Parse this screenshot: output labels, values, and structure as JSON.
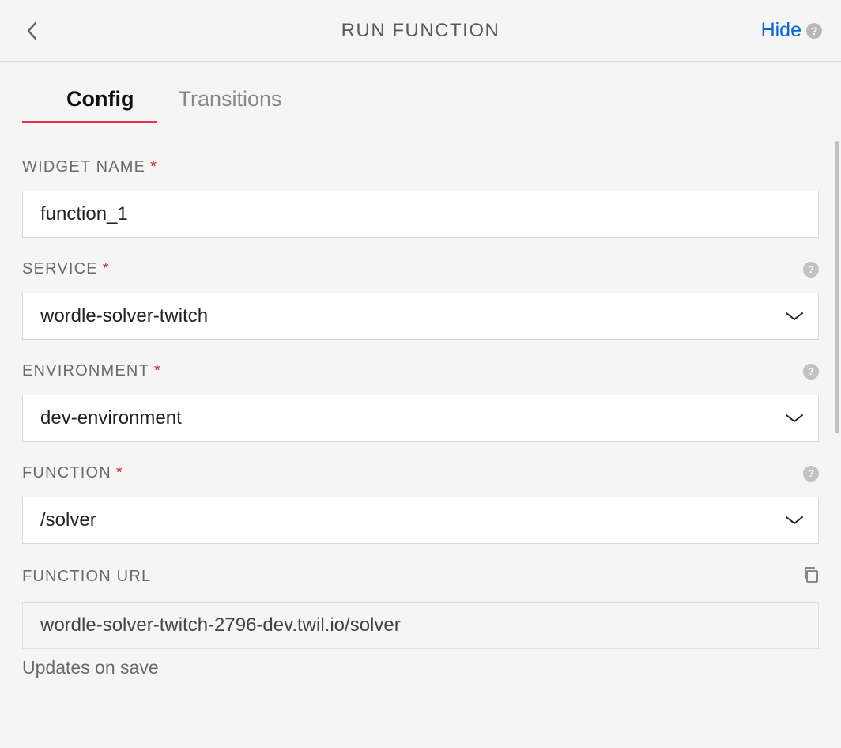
{
  "header": {
    "title": "RUN FUNCTION",
    "hide_label": "Hide"
  },
  "tabs": [
    {
      "label": "Config",
      "active": true
    },
    {
      "label": "Transitions",
      "active": false
    }
  ],
  "fields": {
    "widget_name": {
      "label": "WIDGET NAME",
      "required": true,
      "value": "function_1"
    },
    "service": {
      "label": "SERVICE",
      "required": true,
      "value": "wordle-solver-twitch",
      "has_help": true
    },
    "environment": {
      "label": "ENVIRONMENT",
      "required": true,
      "value": "dev-environment",
      "has_help": true
    },
    "function": {
      "label": "FUNCTION",
      "required": true,
      "value": "/solver",
      "has_help": true
    },
    "function_url": {
      "label": "FUNCTION URL",
      "required": false,
      "value": "wordle-solver-twitch-2796-dev.twil.io/solver",
      "hint": "Updates on save"
    }
  }
}
